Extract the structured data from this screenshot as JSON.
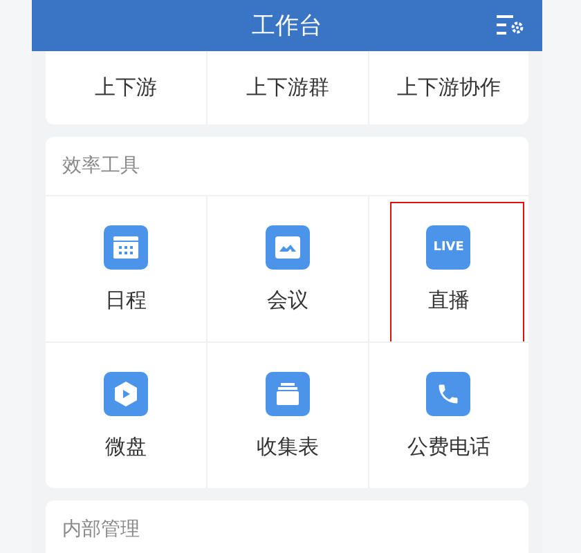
{
  "header": {
    "title": "工作台"
  },
  "sections": [
    {
      "items": [
        {
          "label": "上下游",
          "highlighted": false
        },
        {
          "label": "上下游群",
          "highlighted": false
        },
        {
          "label": "上下游协作",
          "highlighted": false
        }
      ]
    },
    {
      "title": "效率工具",
      "items": [
        {
          "label": "日程",
          "highlighted": false
        },
        {
          "label": "会议",
          "highlighted": false
        },
        {
          "label": "直播",
          "icon_text": "LIVE",
          "highlighted": true
        },
        {
          "label": "微盘",
          "highlighted": false
        },
        {
          "label": "收集表",
          "highlighted": false
        },
        {
          "label": "公费电话",
          "highlighted": false
        }
      ]
    },
    {
      "title": "内部管理"
    }
  ]
}
